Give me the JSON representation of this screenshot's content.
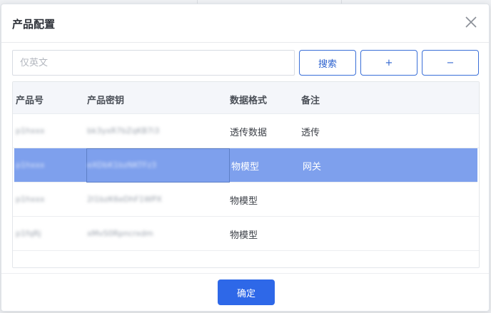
{
  "dialog": {
    "title": "产品配置",
    "close_icon": "close-icon"
  },
  "toolbar": {
    "search_placeholder": "仅英文",
    "search_label": "搜索",
    "add_label": "+",
    "remove_label": "−"
  },
  "table": {
    "columns": [
      "产品号",
      "产品密钥",
      "数据格式",
      "备注"
    ],
    "rows": [
      {
        "product_no": "p1hxxx",
        "product_key": "bk3yxR7bZqKB7i3",
        "format": "透传数据",
        "note": "透传",
        "selected": false
      },
      {
        "product_no": "p1hxxx",
        "product_key": "eXDbK1bzNKTFz3",
        "format": "物模型",
        "note": "网关",
        "selected": true
      },
      {
        "product_no": "p1hxxx",
        "product_key": "2I1bzK6eDhF1WPX",
        "format": "物模型",
        "note": "",
        "selected": false
      },
      {
        "product_no": "p1fqRj",
        "product_key": "xMvS0Rpncrxdm",
        "format": "物模型",
        "note": "",
        "selected": false
      }
    ]
  },
  "footer": {
    "confirm_label": "确定"
  }
}
